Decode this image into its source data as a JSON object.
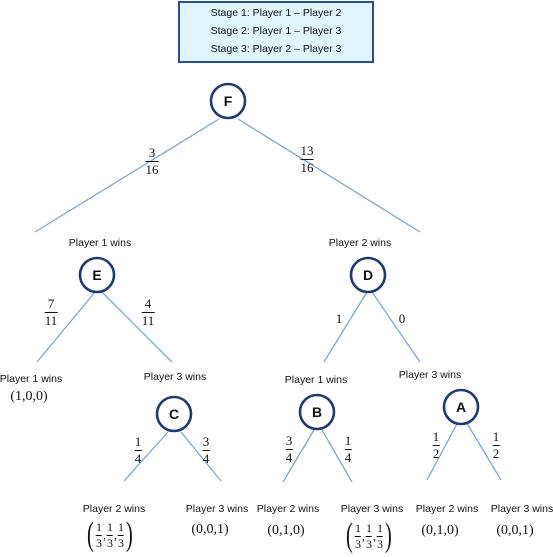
{
  "legend": {
    "stages": [
      "Stage 1:  Player 1 – Player 2",
      "Stage 2:  Player 1 – Player 3",
      "Stage 3:  Player 2 – Player 3"
    ]
  },
  "colors": {
    "node_stroke": "#1f3a6e",
    "edge": "#7ea6d8",
    "legend_fill": "#dff4fb",
    "legend_border": "#2c4f87"
  },
  "nodes": {
    "F": {
      "letter": "F"
    },
    "E": {
      "letter": "E",
      "label": "Player 1 wins"
    },
    "D": {
      "letter": "D",
      "label": "Player 2 wins"
    },
    "C": {
      "letter": "C",
      "label": "Player 3 wins"
    },
    "B": {
      "letter": "B",
      "label": "Player 1 wins"
    },
    "A": {
      "letter": "A",
      "label": "Player 3 wins"
    }
  },
  "edges": {
    "F_E": {
      "num": "3",
      "den": "16"
    },
    "F_D": {
      "num": "13",
      "den": "16"
    },
    "E_leaf": {
      "num": "7",
      "den": "11"
    },
    "E_C": {
      "num": "4",
      "den": "11"
    },
    "D_B": {
      "value": "1"
    },
    "D_A": {
      "value": "0"
    },
    "C_l": {
      "num": "1",
      "den": "4"
    },
    "C_r": {
      "num": "3",
      "den": "4"
    },
    "B_l": {
      "num": "3",
      "den": "4"
    },
    "B_r": {
      "num": "1",
      "den": "4"
    },
    "A_l": {
      "num": "1",
      "den": "2"
    },
    "A_r": {
      "num": "1",
      "den": "2"
    }
  },
  "leaves": {
    "E_leaf": {
      "label": "Player 1 wins",
      "payoff": "(1,0,0)"
    },
    "C_l": {
      "label": "Player 2 wins",
      "payoff_fracs": [
        "1/3",
        "1/3",
        "1/3"
      ],
      "num": "1",
      "den": "3"
    },
    "C_r": {
      "label": "Player 3 wins",
      "payoff": "(0,0,1)"
    },
    "B_l": {
      "label": "Player 2 wins",
      "payoff": "(0,1,0)"
    },
    "B_r": {
      "label": "Player 3 wins",
      "payoff_fracs": [
        "1/3",
        "1/3",
        "1/3"
      ],
      "num": "1",
      "den": "3"
    },
    "A_l": {
      "label": "Player 2 wins",
      "payoff": "(0,1,0)"
    },
    "A_r": {
      "label": "Player 3 wins",
      "payoff": "(0,0,1)"
    }
  }
}
